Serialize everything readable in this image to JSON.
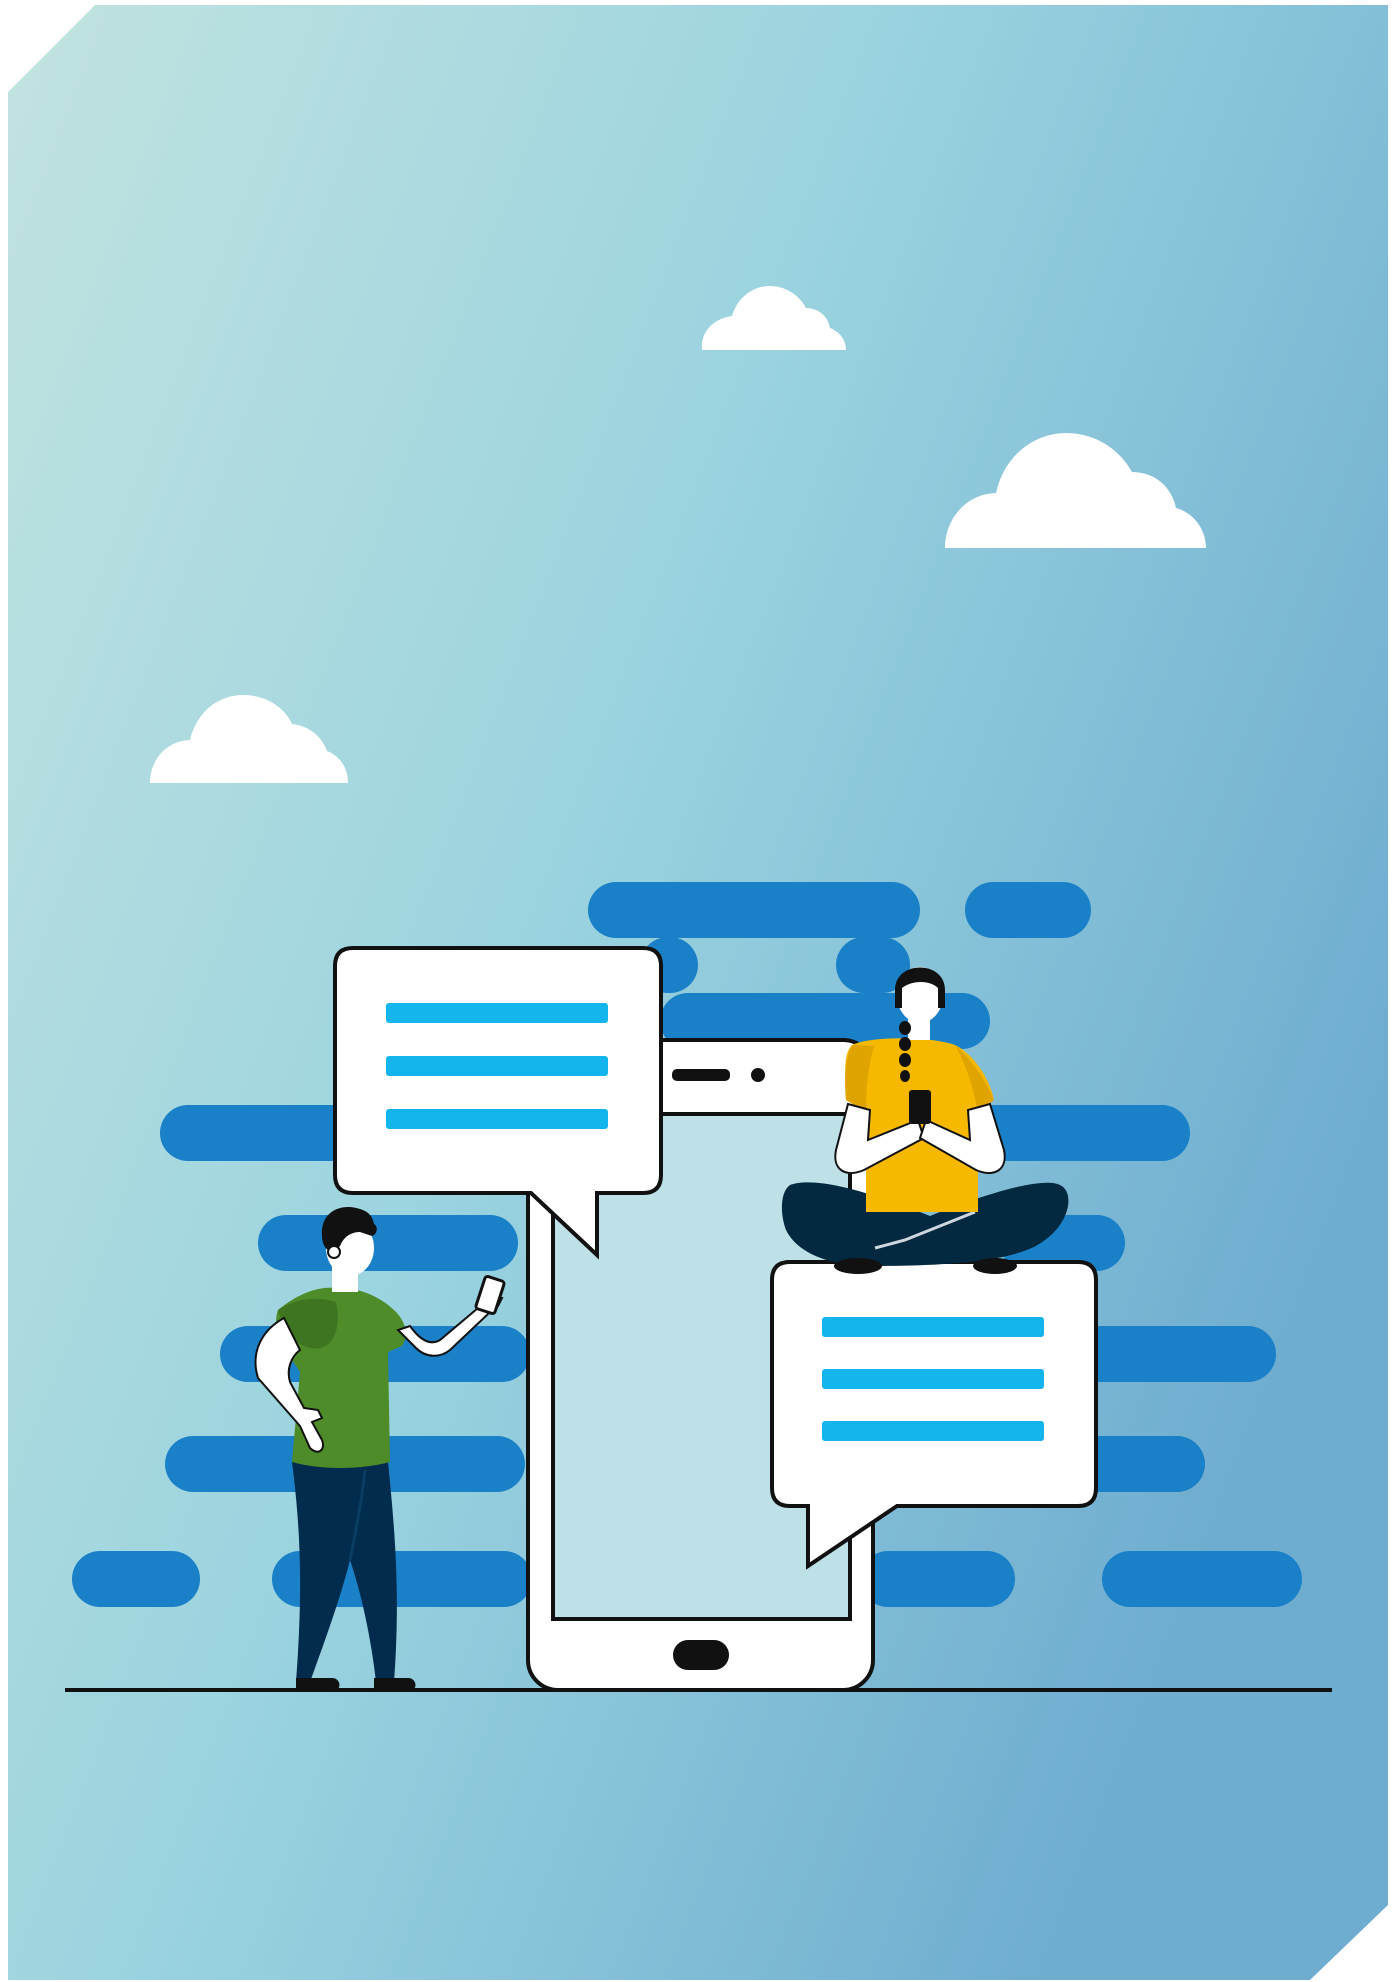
{
  "illustration": {
    "palette": {
      "background_start": "#c2e3e0",
      "background_mid": "#9ad3df",
      "background_end": "#6fadd0",
      "cloud": "#ffffff",
      "stripe": "#1a80c8",
      "bubble_line": "#14b5ec",
      "phone_screen": "#bde1e7",
      "phone_body": "#ffffff",
      "outline": "#111111",
      "man_shirt": "#4e8c2a",
      "man_shirt_shadow": "#3d7520",
      "man_pants": "#022c4e",
      "woman_shirt": "#f7b800",
      "woman_shirt_shadow": "#e0a400",
      "woman_pants": "#02293f",
      "skin": "#ffffff",
      "hair": "#111111"
    },
    "icons": [
      "cloud-icon",
      "speech-bubble-icon",
      "smartphone-icon",
      "person-icon"
    ]
  }
}
